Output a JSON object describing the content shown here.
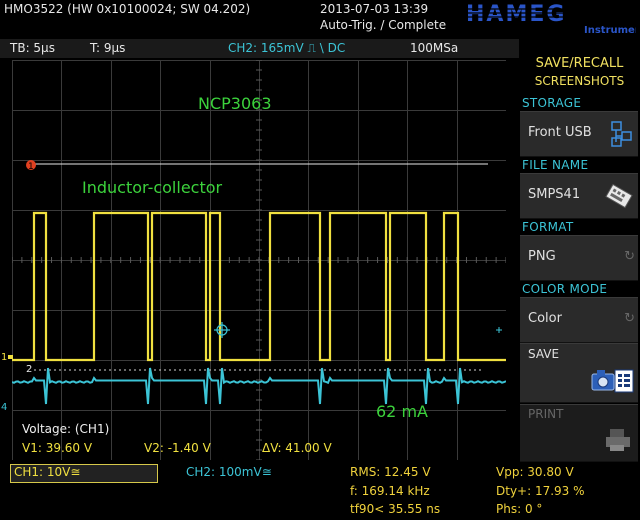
{
  "header": {
    "model": "HMO3522 (HW 0x10100024; SW 04.202)",
    "datetime": "2013-07-03 13:39",
    "trigger_state": "Auto-Trig. / Complete",
    "logo_text": "HAMEG",
    "logo_sub": "Instruments"
  },
  "status": {
    "timebase": "TB: 5µs",
    "trigger_time": "T: 9µs",
    "ch2_setting": "CH2: 165mV ⎍ \\ DC",
    "sample_rate": "100MSa"
  },
  "screen": {
    "label_top": "NCP3063",
    "label_mid": "Inductor-collector",
    "label_current": "62 mA",
    "cursor_title": "Voltage: (CH1)",
    "v1": "V1: 39.60 V",
    "v2": "V2: -1.40 V",
    "dv": "ΔV: 41.00 V",
    "marker_ch1": "1",
    "marker_ch2": "2",
    "marker_ch4": "4"
  },
  "bottom": {
    "ch1": "CH1: 10V≅",
    "ch2": "CH2: 100mV≅",
    "rms": "RMS: 12.45 V",
    "freq": "f: 169.14 kHz",
    "tf90": "tf90< 35.55 ns",
    "vpp": "Vpp: 30.80 V",
    "dty": "Dty+: 17.93 %",
    "phs": "Phs: 0 °"
  },
  "menu": {
    "title_line1": "SAVE/RECALL",
    "title_line2": "SCREENSHOTS",
    "storage_label": "STORAGE",
    "storage_value": "Front USB",
    "filename_label": "FILE NAME",
    "filename_value": "SMPS41",
    "format_label": "FORMAT",
    "format_value": "PNG",
    "colormode_label": "COLOR MODE",
    "colormode_value": "Color",
    "save_label": "SAVE",
    "print_label": "PRINT"
  },
  "colors": {
    "ch1": "#f0e040",
    "ch2": "#3cc4d6",
    "annotation": "#3cd23c",
    "trigger_marker": "#e04020"
  }
}
